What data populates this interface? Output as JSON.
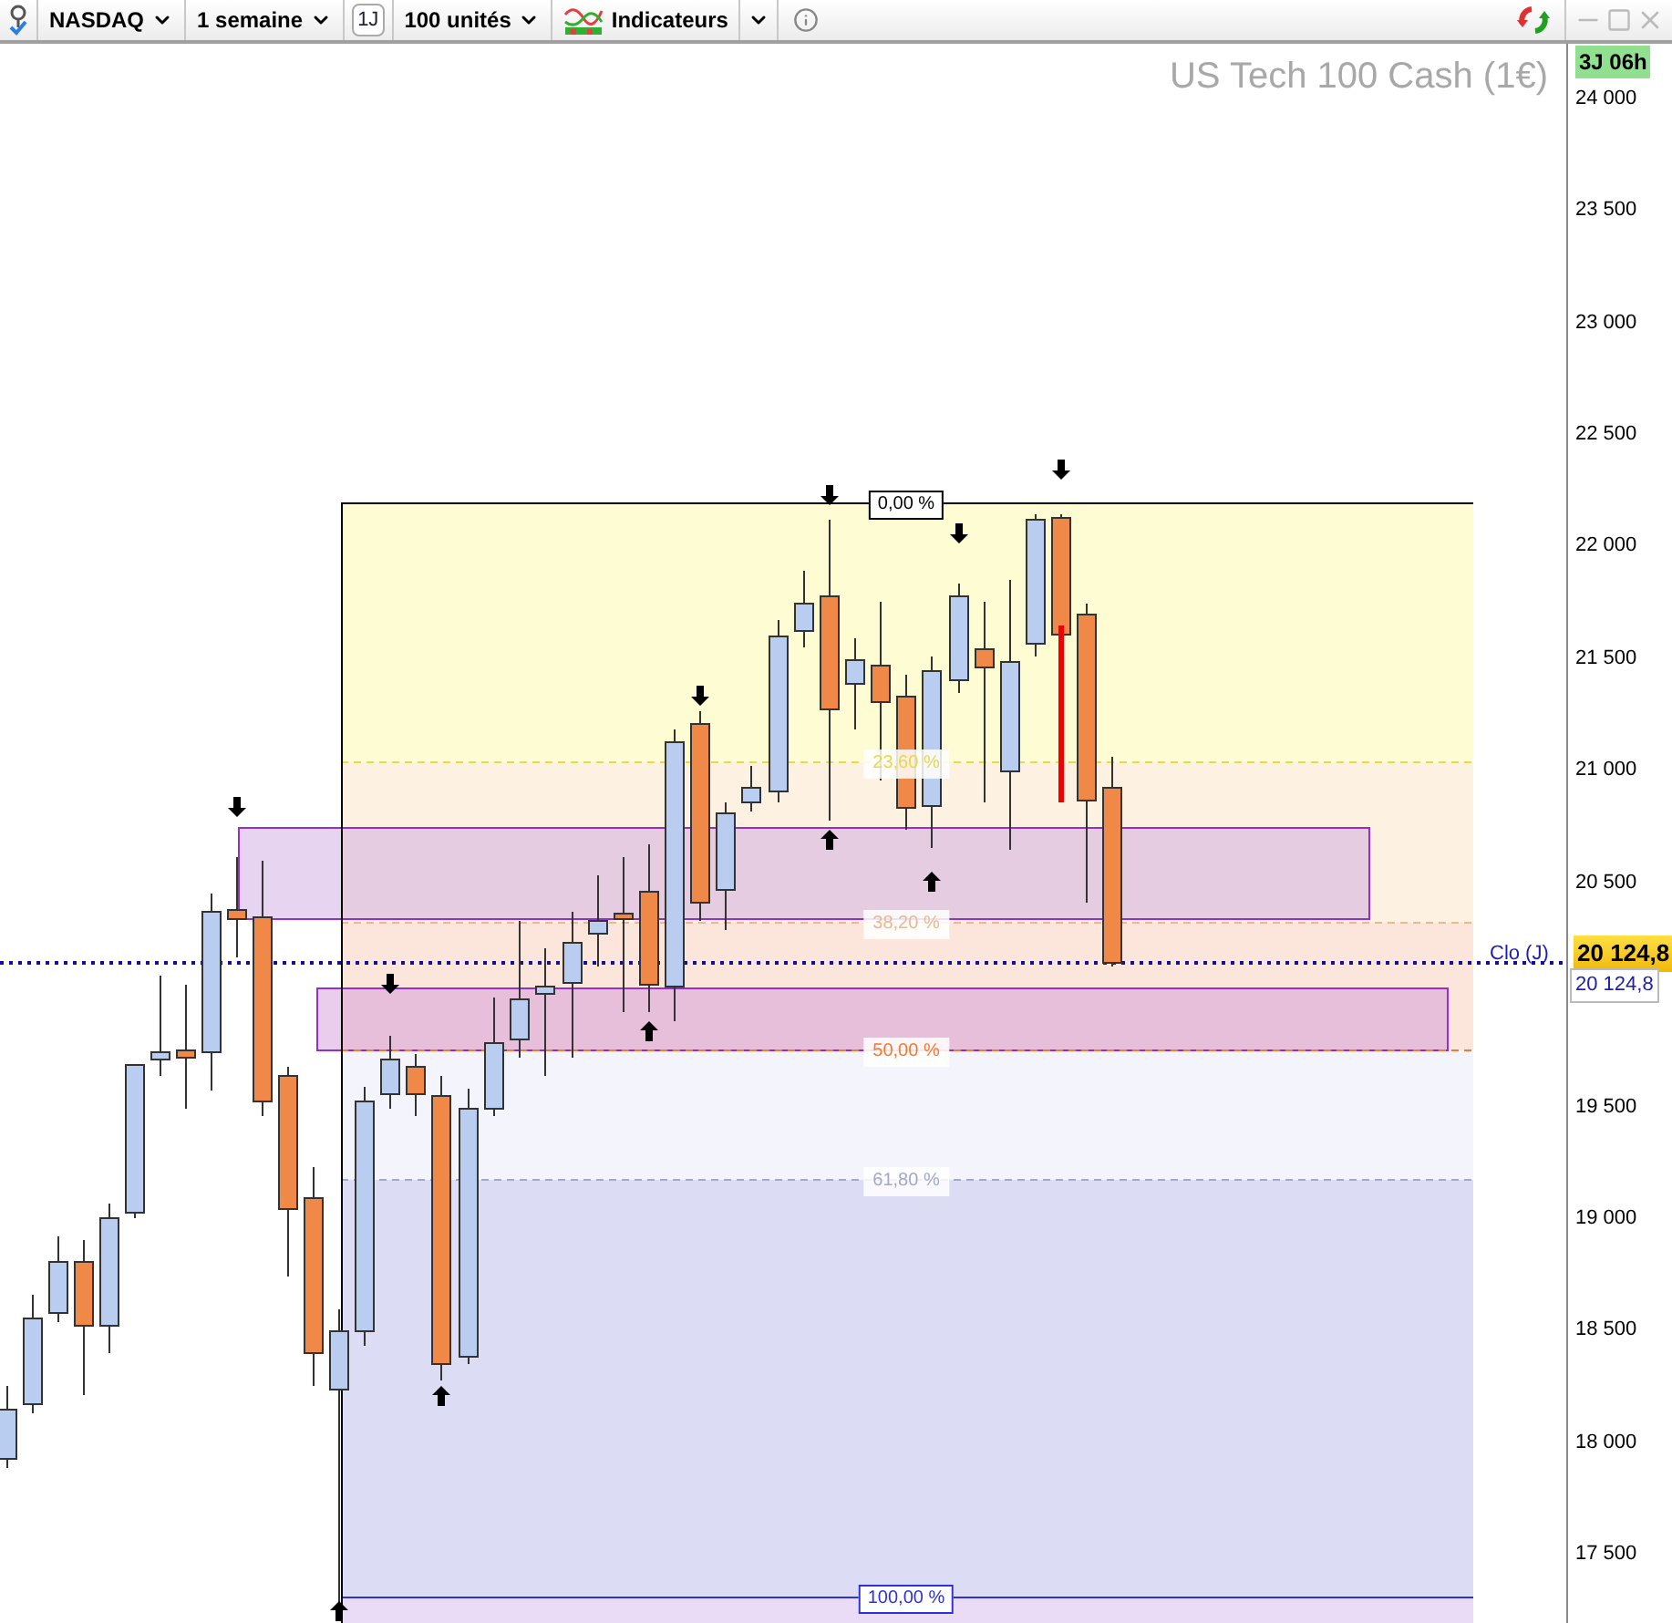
{
  "toolbar": {
    "symbol": "NASDAQ",
    "period": "1 semaine",
    "interval": "1J",
    "units": "100 unités",
    "indicators": "Indicateurs"
  },
  "chart": {
    "title": "US Tech 100 Cash (1€)",
    "countdown": "3J 06h",
    "close_label": "Clo (J)",
    "last_price": "20 124,8",
    "price_tag": "20 124,8",
    "y_axis": [
      "24 000",
      "23 500",
      "23 000",
      "22 500",
      "22 000",
      "21 500",
      "21 000",
      "20 500",
      "19 500",
      "19 000",
      "18 500",
      "18 000",
      "17 500"
    ],
    "fib_levels": [
      {
        "label": "0,00 %",
        "color": "#000000"
      },
      {
        "label": "23,60 %",
        "color": "#e8d84a"
      },
      {
        "label": "38,20 %",
        "color": "#e8b890"
      },
      {
        "label": "50,00 %",
        "color": "#f07a30"
      },
      {
        "label": "61,80 %",
        "color": "#a0a8cc"
      },
      {
        "label": "100,00 %",
        "color": "#3030d8"
      }
    ]
  }
}
